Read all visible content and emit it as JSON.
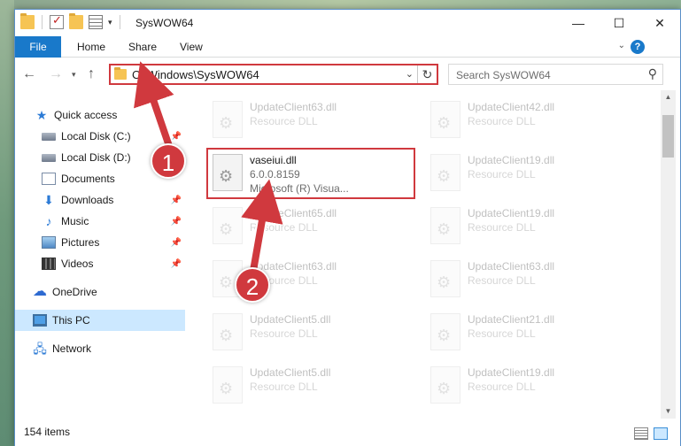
{
  "window": {
    "title": "SysWOW64",
    "controls": {
      "minimize": "—",
      "maximize": "☐",
      "close": "✕"
    }
  },
  "ribbon": {
    "tabs": [
      "File",
      "Home",
      "Share",
      "View"
    ],
    "help": "?"
  },
  "address": {
    "path": "C:\\Windows\\SysWOW64",
    "refresh_icon": "↻",
    "search_placeholder": "Search SysWOW64"
  },
  "nav": {
    "items": [
      {
        "label": "Quick access",
        "icon": "star-icon",
        "pinned": false
      },
      {
        "label": "Local Disk (C:)",
        "icon": "disk-icon",
        "pinned": true
      },
      {
        "label": "Local Disk (D:)",
        "icon": "disk-icon",
        "pinned": false
      },
      {
        "label": "Documents",
        "icon": "document-icon",
        "pinned": false
      },
      {
        "label": "Downloads",
        "icon": "download-icon",
        "pinned": true
      },
      {
        "label": "Music",
        "icon": "music-icon",
        "pinned": true
      },
      {
        "label": "Pictures",
        "icon": "pictures-icon",
        "pinned": true
      },
      {
        "label": "Videos",
        "icon": "video-icon",
        "pinned": true
      },
      {
        "label": "OneDrive",
        "icon": "cloud-icon",
        "pinned": false
      },
      {
        "label": "This PC",
        "icon": "pc-icon",
        "pinned": false,
        "selected": true
      },
      {
        "label": "Network",
        "icon": "network-icon",
        "pinned": false
      }
    ]
  },
  "files": {
    "left": [
      {
        "name": "UpdateClient63.dll",
        "type": "Resource DLL"
      },
      {
        "name": "vaseiui.dll",
        "version": "6.0.0.8159",
        "company": "Microsoft (R) Visua..."
      },
      {
        "name": "UpdateClient65.dll",
        "type": "Resource DLL"
      },
      {
        "name": "UpdateClient63.dll",
        "type": "Resource DLL"
      },
      {
        "name": "UpdateClient5.dll",
        "type": "Resource DLL"
      },
      {
        "name": "UpdateClient5.dll",
        "type": "Resource DLL"
      }
    ],
    "right": [
      {
        "name": "UpdateClient42.dll",
        "type": "Resource DLL"
      },
      {
        "name": "UpdateClient19.dll",
        "type": "Resource DLL"
      },
      {
        "name": "UpdateClient19.dll",
        "type": "Resource DLL"
      },
      {
        "name": "UpdateClient63.dll",
        "type": "Resource DLL"
      },
      {
        "name": "UpdateClient21.dll",
        "type": "Resource DLL"
      },
      {
        "name": "UpdateClient19.dll",
        "type": "Resource DLL"
      }
    ]
  },
  "status": {
    "count": "154 items"
  },
  "annotations": {
    "badge1": "1",
    "badge2": "2",
    "color": "#d0393e"
  }
}
